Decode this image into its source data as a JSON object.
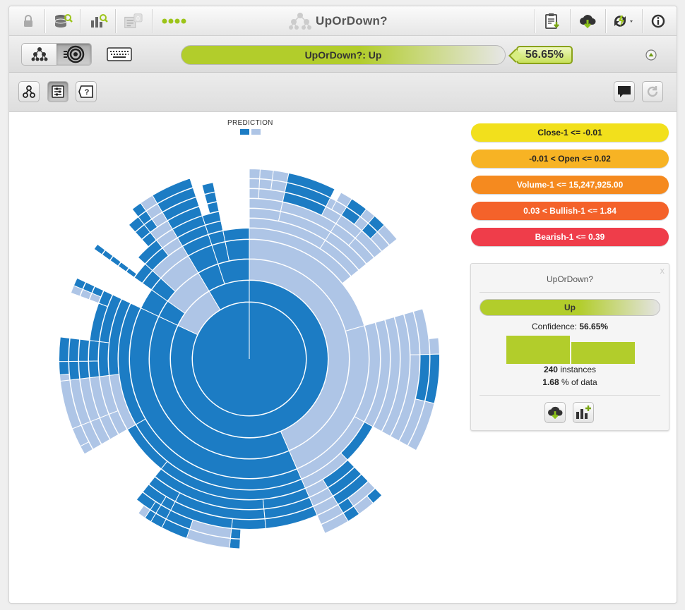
{
  "model": {
    "name": "UpOrDown?"
  },
  "toolbar": {
    "dataset_count": "0",
    "icons": [
      "lock-icon",
      "dataset-search-icon",
      "model-search-icon",
      "task-icon",
      "progress-dots-icon",
      "clipboard-icon",
      "download-icon",
      "predict-icon",
      "info-icon"
    ]
  },
  "prediction": {
    "label": "UpOrDown?: Up",
    "confidence": "56.65%"
  },
  "legend": {
    "title": "PREDICTION",
    "colors": [
      "#1c7cc4",
      "#aec5e6"
    ]
  },
  "rules": [
    {
      "text": "Close-1 <= -0.01",
      "color": "#f2e01c",
      "text_color": "#222222"
    },
    {
      "text": "-0.01 < Open <= 0.02",
      "color": "#f7b324",
      "text_color": "#222222"
    },
    {
      "text": "Volume-1 <= 15,247,925.00",
      "color": "#f58a1f",
      "text_color": "#ffffff"
    },
    {
      "text": "0.03 < Bullish-1 <= 1.84",
      "color": "#f4622a",
      "text_color": "#ffffff"
    },
    {
      "text": "Bearish-1 <= 0.39",
      "color": "#ef3d4a",
      "text_color": "#ffffff"
    }
  ],
  "node_card": {
    "title": "UpOrDown?",
    "prediction": "Up",
    "confidence_label": "Confidence:",
    "confidence_value": "56.65%",
    "distribution": [
      0.5665,
      0.4335
    ],
    "instances_value": "240",
    "instances_label": "instances",
    "percent_value": "1.68",
    "percent_label": "% of data",
    "close": "x"
  },
  "colors": {
    "accent_green": "#b2cd2b",
    "dark_blue": "#1c7cc4",
    "light_blue": "#aec5e6"
  }
}
